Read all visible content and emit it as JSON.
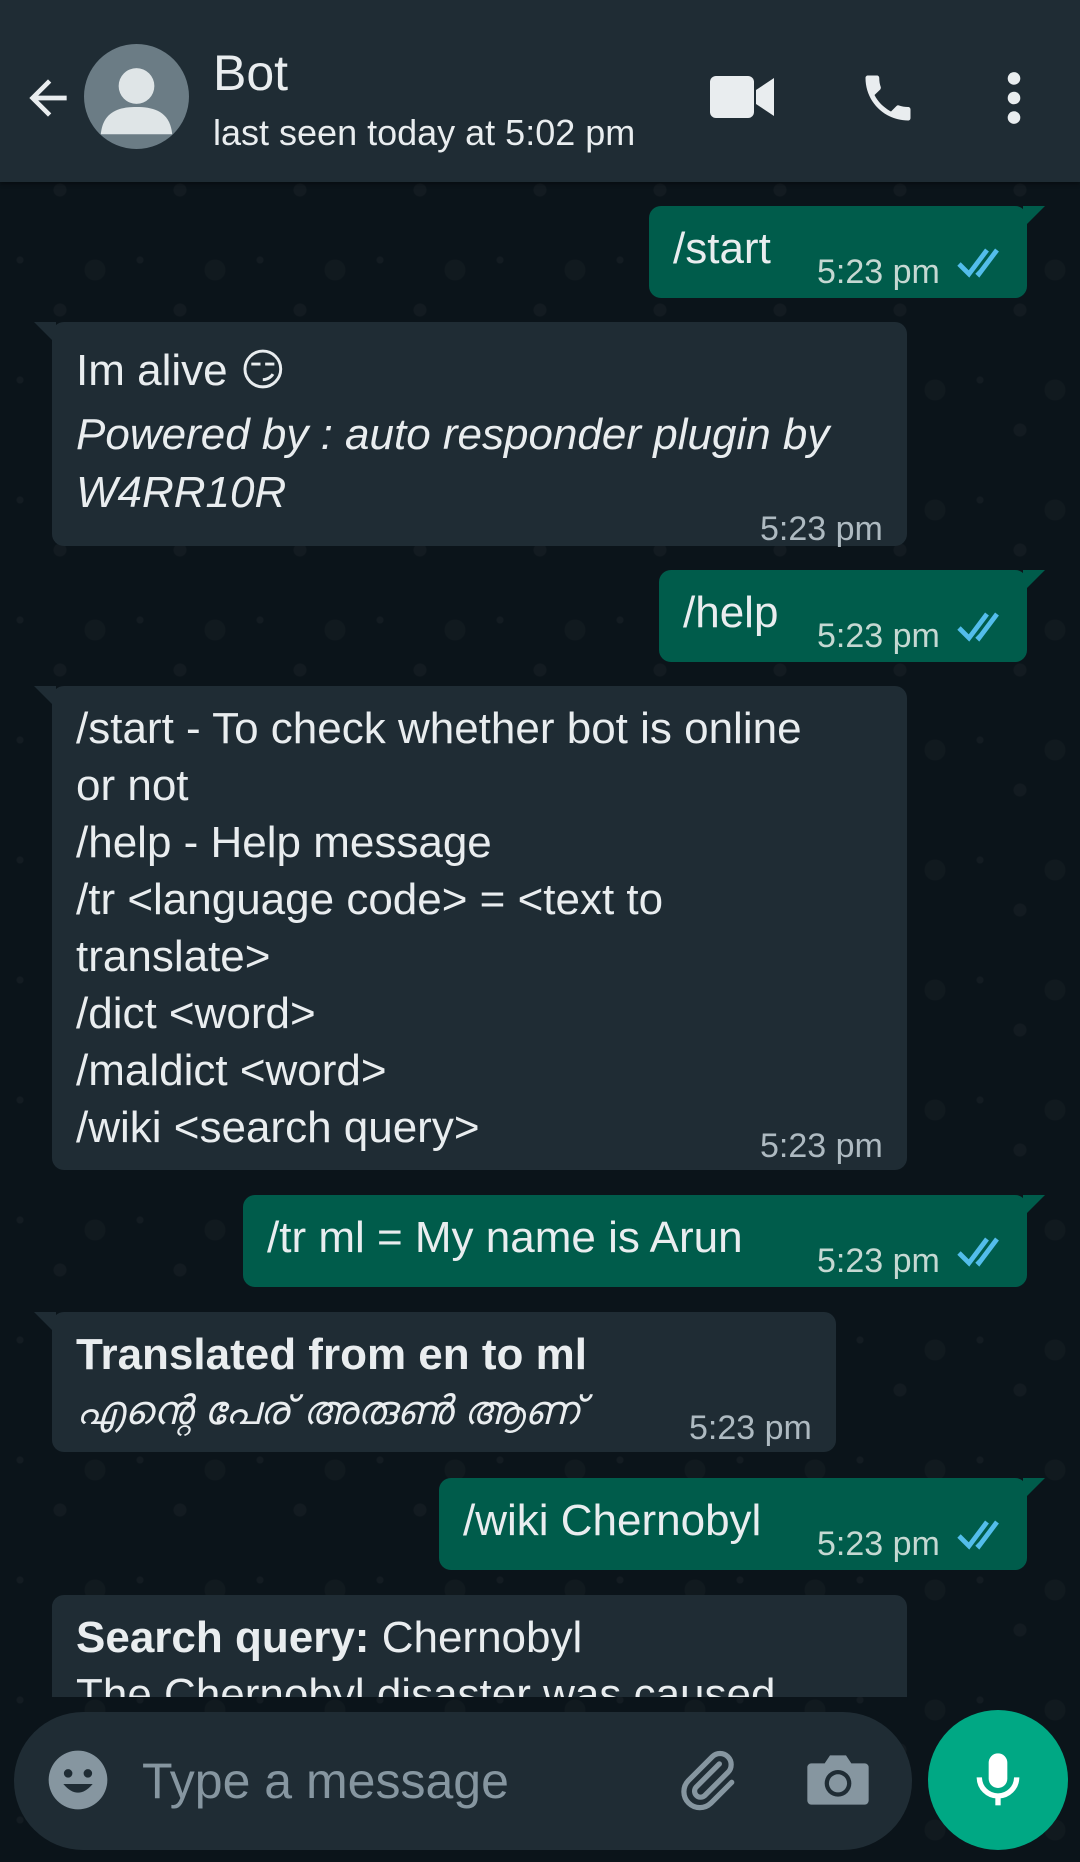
{
  "header": {
    "contact_name": "Bot",
    "status": "last seen today at 5:02 pm"
  },
  "messages": [
    {
      "direction": "outgoing",
      "text": "/start",
      "time": "5:23 pm",
      "read": true
    },
    {
      "direction": "incoming",
      "line1": "Im alive 😏",
      "line2": "Powered by : auto responder plugin by",
      "line3": "W4RR10R",
      "time": "5:23 pm"
    },
    {
      "direction": "outgoing",
      "text": "/help",
      "time": "5:23 pm",
      "read": true
    },
    {
      "direction": "incoming",
      "lines": [
        "/start - To check whether bot is online",
        "or not",
        "/help - Help message",
        "/tr <language code> = <text to",
        "translate>",
        "/dict <word>",
        "/maldict <word>",
        "/wiki <search query>"
      ],
      "time": "5:23 pm"
    },
    {
      "direction": "outgoing",
      "text": "/tr ml = My name is Arun",
      "time": "5:23 pm",
      "read": true
    },
    {
      "direction": "incoming",
      "heading": "Translated from en to ml",
      "body": "എന്റെ പേര് അരുൺ ആണ്",
      "time": "5:23 pm"
    },
    {
      "direction": "outgoing",
      "text": "/wiki Chernobyl",
      "time": "5:23 pm",
      "read": true
    },
    {
      "direction": "incoming",
      "label": "Search query:",
      "value": " Chernobyl",
      "body": "The Chernobyl disaster was caused"
    }
  ],
  "composer": {
    "placeholder": "Type a message"
  },
  "icons": {
    "back": "arrow-left-icon",
    "avatar": "person-icon",
    "video": "video-camera-icon",
    "phone": "phone-icon",
    "more": "more-vert-icon",
    "emoji": "emoji-icon",
    "attach": "paperclip-icon",
    "camera": "camera-icon",
    "mic": "microphone-icon",
    "read_receipt": "double-check-icon"
  },
  "colors": {
    "header_bg": "#1f2c34",
    "incoming_bubble": "#1f2c34",
    "outgoing_bubble": "#005c4b",
    "accent": "#00a884",
    "read_tick": "#53bdeb"
  }
}
